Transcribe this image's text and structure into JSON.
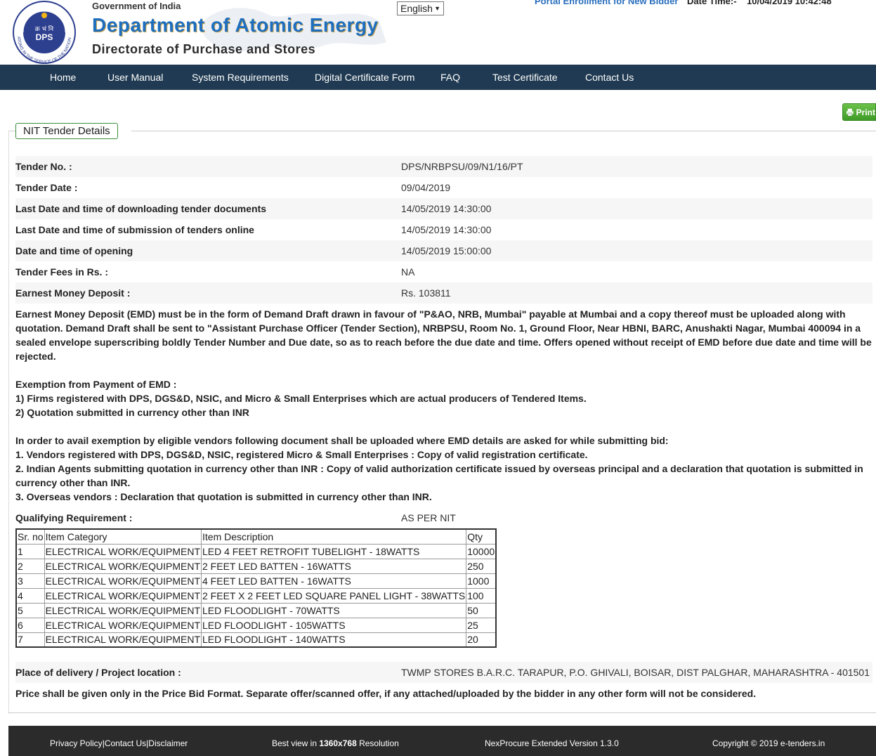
{
  "header": {
    "gov_line": "Government of India",
    "dept_title": "Department of Atomic Energy",
    "directorate": "Directorate of Purchase and Stores",
    "logo": {
      "center_text": "DPS",
      "hindi_text": "क्र भं नि",
      "ring_text": "ATOMS IN THE SERVICE OF THE NATION"
    },
    "language": "English",
    "enroll_link": "Portal Enrollment for New Bidder",
    "datetime_label": "Date Time:-",
    "datetime_value": "10/04/2019 10:42:48"
  },
  "nav": [
    "Home",
    "User Manual",
    "System Requirements",
    "Digital Certificate Form",
    "FAQ",
    "Test Certificate",
    "Contact Us"
  ],
  "print_label": "Print",
  "section_title": "NIT Tender Details",
  "details": [
    {
      "label": "Tender No. :",
      "value": "DPS/NRBPSU/09/N1/16/PT"
    },
    {
      "label": "Tender Date :",
      "value": "09/04/2019"
    },
    {
      "label": "Last Date and time of downloading tender documents",
      "value": "14/05/2019 14:30:00"
    },
    {
      "label": "Last Date and time of submission of tenders online",
      "value": "14/05/2019 14:30:00"
    },
    {
      "label": "Date and time of opening",
      "value": "14/05/2019 15:00:00"
    },
    {
      "label": "Tender Fees in Rs. :",
      "value": "NA"
    },
    {
      "label": "Earnest Money Deposit :",
      "value": "Rs. 103811"
    }
  ],
  "emd_text": {
    "lines": [
      "Earnest Money Deposit (EMD) must be in the form of Demand Draft drawn in favour of \"P&AO, NRB, Mumbai\" payable at Mumbai and a copy thereof must be uploaded along with",
      "quotation. Demand Draft shall be sent to \"Assistant Purchase Officer (Tender Section), NRBPSU, Room No. 1, Ground Floor, Near HBNI, BARC, Anushakti Nagar, Mumbai 400094 in a",
      "sealed envelope superscribing boldly Tender Number and Due date, so as to reach before the due date and time. Offers opened without receipt of EMD before due date and time will be",
      "rejected.",
      "",
      "Exemption from Payment of EMD :",
      "1) Firms registered with DPS, DGS&D, NSIC, and Micro & Small Enterprises which are actual producers of Tendered Items.",
      "2) Quotation submitted in currency other than INR",
      "",
      "In order to avail exemption by eligible vendors following document shall be uploaded where EMD details are asked for while submitting bid:",
      "1. Vendors registered with DPS, DGS&D, NSIC, registered Micro & Small Enterprises : Copy of valid registration certificate.",
      "2. Indian Agents submitting quotation in currency other than INR : Copy of valid authorization certificate issued by overseas principal and a declaration that quotation is submitted in",
      "currency other than INR.",
      "3. Overseas vendors : Declaration that quotation is submitted in currency other than INR."
    ]
  },
  "qualifying": {
    "label": "Qualifying Requirement :",
    "value": "AS PER NIT"
  },
  "items": {
    "headers": [
      "Sr. no",
      "Item Category",
      "Item Description",
      "Qty"
    ],
    "rows": [
      [
        "1",
        "ELECTRICAL WORK/EQUIPMENT",
        "LED 4 FEET RETROFIT TUBELIGHT - 18WATTS",
        "10000"
      ],
      [
        "2",
        "ELECTRICAL WORK/EQUIPMENT",
        "2 FEET LED BATTEN - 16WATTS",
        "250"
      ],
      [
        "3",
        "ELECTRICAL WORK/EQUIPMENT",
        "4 FEET LED BATTEN - 16WATTS",
        "1000"
      ],
      [
        "4",
        "ELECTRICAL WORK/EQUIPMENT",
        "2 FEET X 2 FEET LED SQUARE PANEL LIGHT - 38WATTS",
        "100"
      ],
      [
        "5",
        "ELECTRICAL WORK/EQUIPMENT",
        "LED FLOODLIGHT - 70WATTS",
        "50"
      ],
      [
        "6",
        "ELECTRICAL WORK/EQUIPMENT",
        "LED FLOODLIGHT - 105WATTS",
        "25"
      ],
      [
        "7",
        "ELECTRICAL WORK/EQUIPMENT",
        "LED FLOODLIGHT - 140WATTS",
        "20"
      ]
    ]
  },
  "delivery": {
    "label": "Place of delivery / Project location :",
    "value": "TWMP STORES B.A.R.C. TARAPUR, P.O. GHIVALI, BOISAR, DIST PALGHAR, MAHARASHTRA - 401501"
  },
  "price_note": "Price shall be given only in the Price Bid Format. Separate offer/scanned offer, if any attached/uploaded by the bidder in any other form will not be considered.",
  "footer": {
    "privacy": "Privacy Policy",
    "contact": "Contact Us",
    "disclaimer": "Disclaimer",
    "sep": "|",
    "best_view_prefix": "Best view in ",
    "best_view_res": "1360x768",
    "best_view_suffix": " Resolution",
    "version": "NexProcure Extended Version 1.3.0",
    "copyright": "Copyright © 2019 e-tenders.in"
  }
}
